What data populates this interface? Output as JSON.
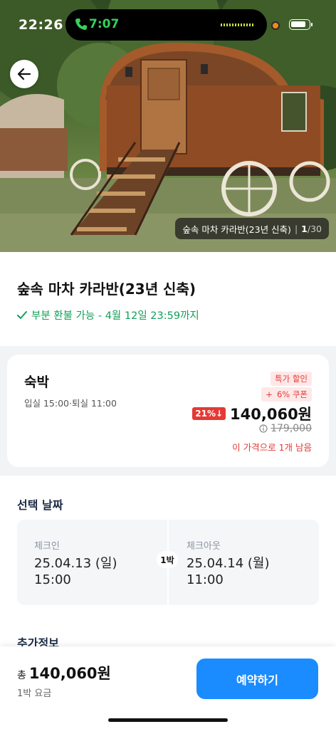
{
  "status_bar": {
    "time": "22:26",
    "call_timer": "7:07"
  },
  "gallery": {
    "caption_name": "숲속 마차 카라반(23년 신축)",
    "current": "1",
    "separator": "/",
    "total": "30"
  },
  "room": {
    "title": "숲속 마차 카라반(23년 신축)",
    "refund_note": "부분 환불 가능 - 4월 12일 23:59까지"
  },
  "offer": {
    "label": "숙박",
    "check_times": "입실 15:00·퇴실 11:00",
    "sale_badge": "특가 할인",
    "coupon_plus": "+",
    "coupon_badge": "6% 쿠폰",
    "discount": "21%↓",
    "price": "140,060원",
    "original_price": "179,000",
    "remaining": "이 가격으로 1개 남음"
  },
  "dates": {
    "section_title": "선택 날짜",
    "checkin_label": "체크인",
    "checkin_date": "25.04.13 (일)",
    "checkin_time": "15:00",
    "nights": "1박",
    "checkout_label": "체크아웃",
    "checkout_date": "25.04.14 (월)",
    "checkout_time": "11:00"
  },
  "extra_info_title": "추가정보",
  "footer": {
    "total_prefix": "총",
    "total_price": "140,060원",
    "sub_label": "1박 요금",
    "book_label": "예약하기"
  },
  "colors": {
    "accent": "#1a8cff",
    "refund_green": "#11a05a",
    "sale_red": "#e53935"
  },
  "icons": [
    "phone-icon",
    "battery-icon",
    "back-arrow-icon",
    "check-icon",
    "info-circle-icon"
  ]
}
